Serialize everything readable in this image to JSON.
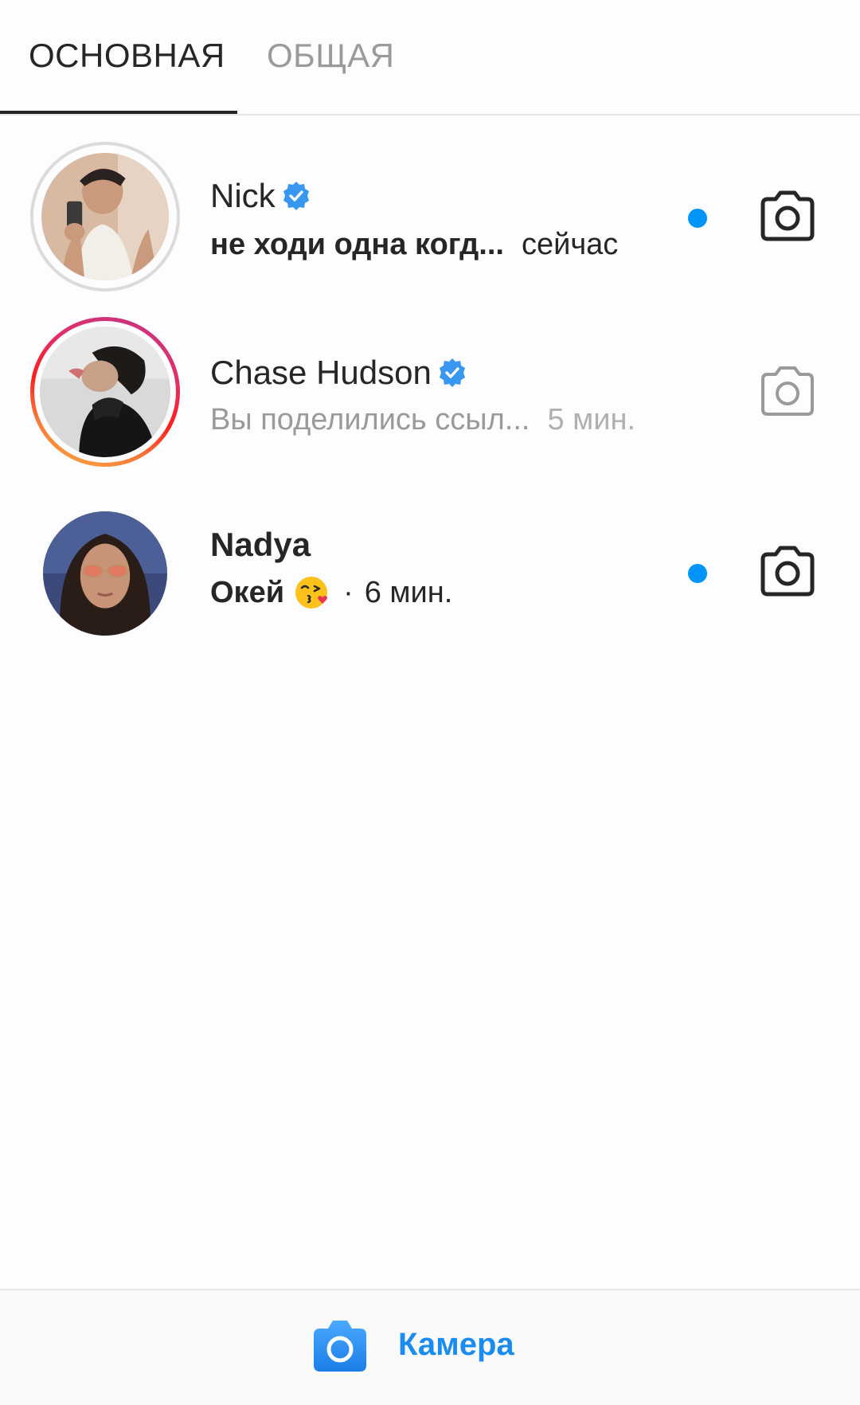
{
  "tabs": {
    "primary": "ОСНОВНАЯ",
    "general": "ОБЩАЯ"
  },
  "threads": [
    {
      "name": "Nick",
      "verified": true,
      "message": "не ходи одна когд...",
      "time": "сейчас",
      "unread": true,
      "story_ring": "seen"
    },
    {
      "name": "Chase Hudson",
      "verified": true,
      "message": "Вы поделились ссыл...",
      "time": "5 мин.",
      "unread": false,
      "story_ring": "unseen"
    },
    {
      "name": "Nadya",
      "verified": false,
      "message": "Окей",
      "message_emoji": "kissing-face-with-heart-emoji",
      "separator": "·",
      "time": "6 мин.",
      "unread": true,
      "story_ring": "none"
    }
  ],
  "bottom_bar": {
    "camera_label": "Камера"
  },
  "colors": {
    "accent_blue": "#0095f6",
    "label_blue": "#1a8cf0",
    "text_primary": "#262626",
    "text_muted": "#9a9a9a"
  },
  "icons": [
    "camera-icon",
    "verified-badge-icon",
    "unread-dot"
  ]
}
